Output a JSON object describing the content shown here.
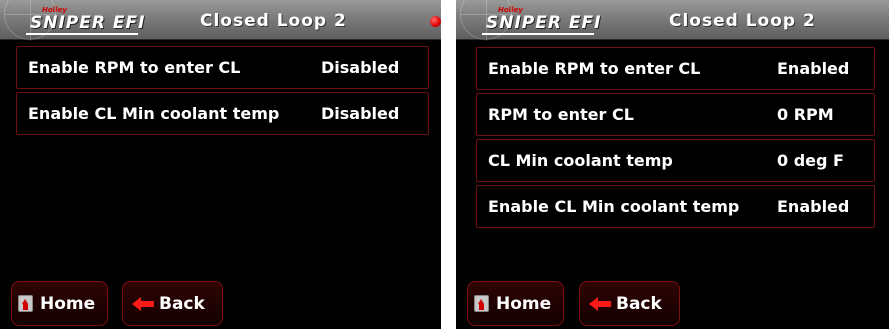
{
  "screens": [
    {
      "brand": "Holley",
      "logo": "SNIPER EFI",
      "title": "Closed Loop 2",
      "rows": [
        {
          "label": "Enable RPM to enter CL",
          "value": "Disabled"
        },
        {
          "label": "Enable CL Min coolant temp",
          "value": "Disabled"
        }
      ],
      "buttons": {
        "home": "Home",
        "back": "Back"
      },
      "status_indicator_color": "#e00000"
    },
    {
      "brand": "Holley",
      "logo": "SNIPER EFI",
      "title": "Closed Loop 2",
      "rows": [
        {
          "label": "Enable RPM to enter CL",
          "value": "Enabled"
        },
        {
          "label": "RPM to enter CL",
          "value": "0 RPM"
        },
        {
          "label": "CL Min coolant temp",
          "value": "0 deg F"
        },
        {
          "label": "Enable CL Min coolant temp",
          "value": "Enabled"
        }
      ],
      "buttons": {
        "home": "Home",
        "back": "Back"
      }
    }
  ],
  "icons": [
    "home-icon",
    "back-arrow-icon",
    "status-dot-icon"
  ],
  "colors": {
    "accent": "#d10000",
    "row_border": "#6e1010",
    "background": "#000000",
    "header": "#7c7c7c"
  }
}
